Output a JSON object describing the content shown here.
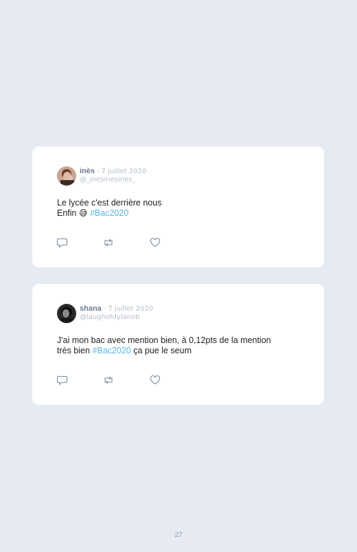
{
  "tweets": [
    {
      "name": "inès",
      "separator": " · ",
      "date": "7 juillet 2020",
      "handle": "@_inesinesines_",
      "avatar_icon": "avatar-photo-ines",
      "lines": [
        {
          "text": "Le lycée c'est derrière nous",
          "hashtag": ""
        },
        {
          "text": "Enfin ",
          "emoji": "😅",
          "hashtag": "#Bac2020"
        }
      ]
    },
    {
      "name": "shana",
      "separator": " · ",
      "date": "7 juillet 2020",
      "handle": "@laughofdylanob",
      "avatar_icon": "avatar-photo-shana",
      "lines": [
        {
          "text": "J'ai mon bac avec mention bien, à 0,12pts de la mention"
        },
        {
          "text": "très bien ",
          "hashtag": "#Bac2020",
          "after": " ça pue le seum"
        }
      ]
    }
  ],
  "actions": {
    "reply_icon": "reply-icon",
    "retweet_icon": "retweet-icon",
    "like_icon": "heart-icon"
  },
  "colors": {
    "background": "#e5eaf3",
    "card": "#ffffff",
    "hashtag": "#5ab4e6",
    "muted": "#b4bdc9"
  },
  "page_number": "27"
}
